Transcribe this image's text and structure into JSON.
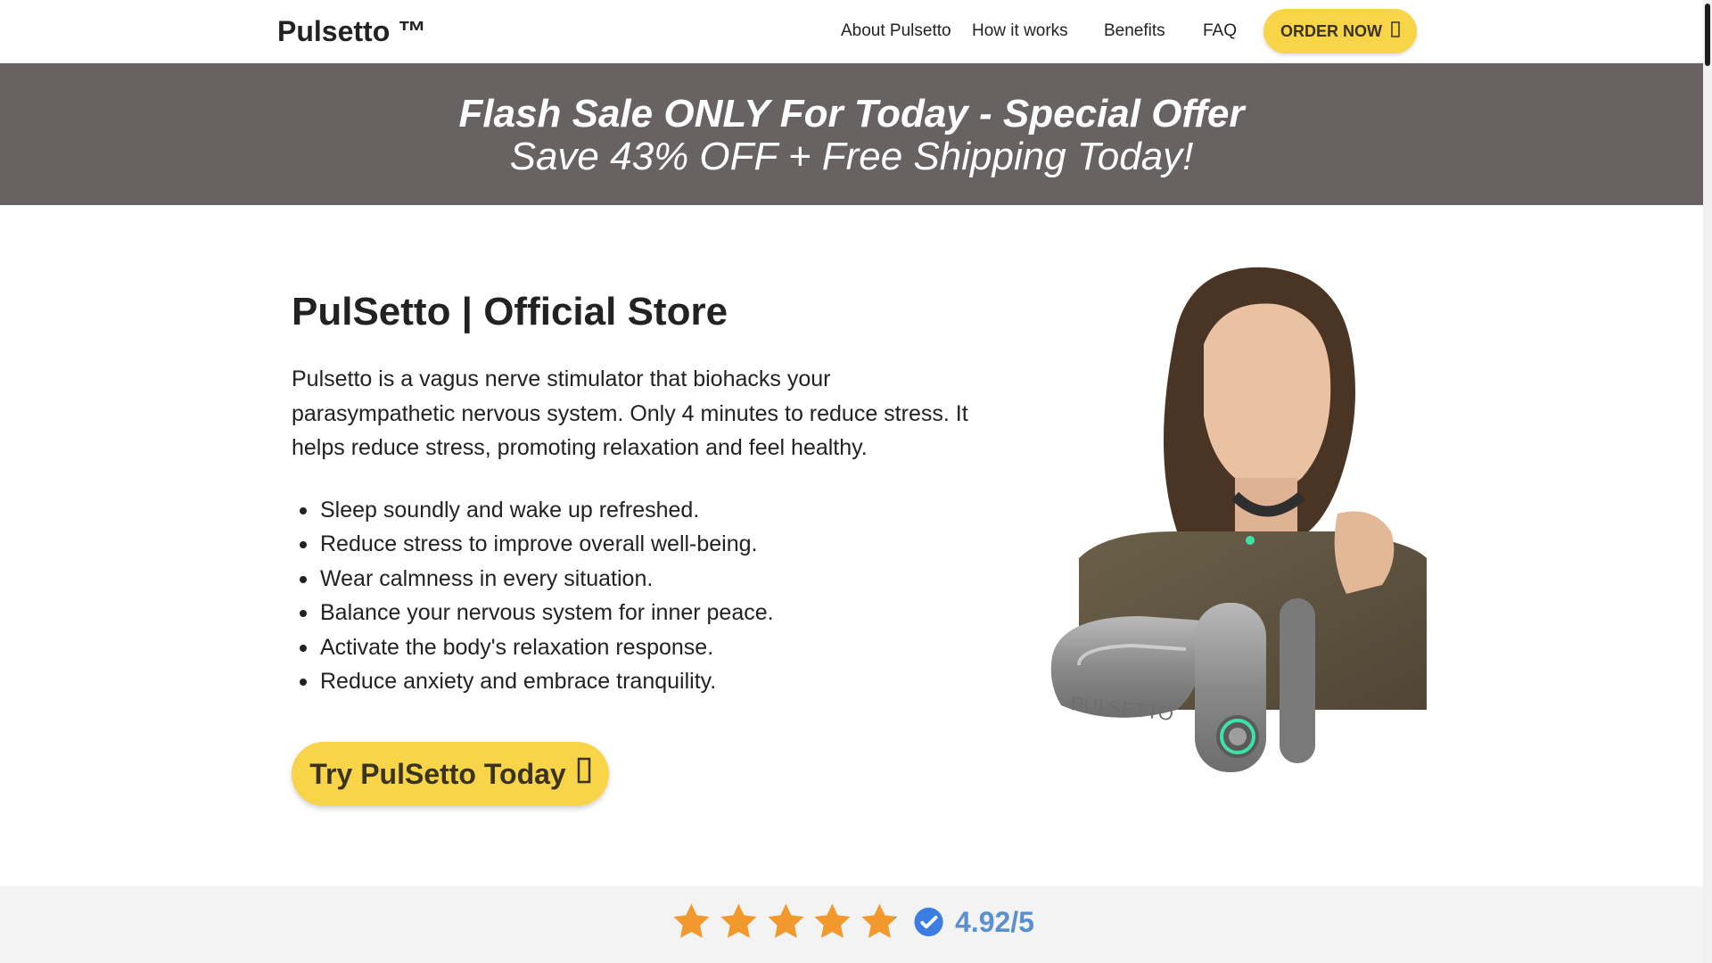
{
  "header": {
    "brand": "Pulsetto ™",
    "nav": [
      "About Pulsetto",
      "How it works",
      "Benefits",
      "FAQ"
    ],
    "order_button": "ORDER NOW",
    "order_icon": "arrow-icon"
  },
  "promo": {
    "line1": "Flash Sale ONLY For Today - Special Offer",
    "line2": "Save 43% OFF + Free Shipping Today!"
  },
  "hero": {
    "title": "PulSetto | Official Store",
    "description": "Pulsetto is a vagus nerve stimulator that biohacks your parasympathetic nervous system. Only 4 minutes to reduce stress. It helps reduce stress, promoting relaxation and feel healthy.",
    "benefits": [
      "Sleep soundly and wake up refreshed.",
      "Reduce stress to improve overall well-being.",
      "Wear calmness in every situation.",
      "Balance your nervous system for inner peace.",
      "Activate the body's relaxation response.",
      "Reduce anxiety and embrace tranquility."
    ],
    "cta": "Try PulSetto Today",
    "cta_icon": "arrow-icon",
    "device_text": "PULSETTO"
  },
  "rating": {
    "value": "4.92/5",
    "stars": 4.92,
    "star_color": "#f2992e",
    "verified_color": "#3b7de0"
  },
  "colors": {
    "accent": "#f8d448",
    "promo_bg": "#696262"
  }
}
